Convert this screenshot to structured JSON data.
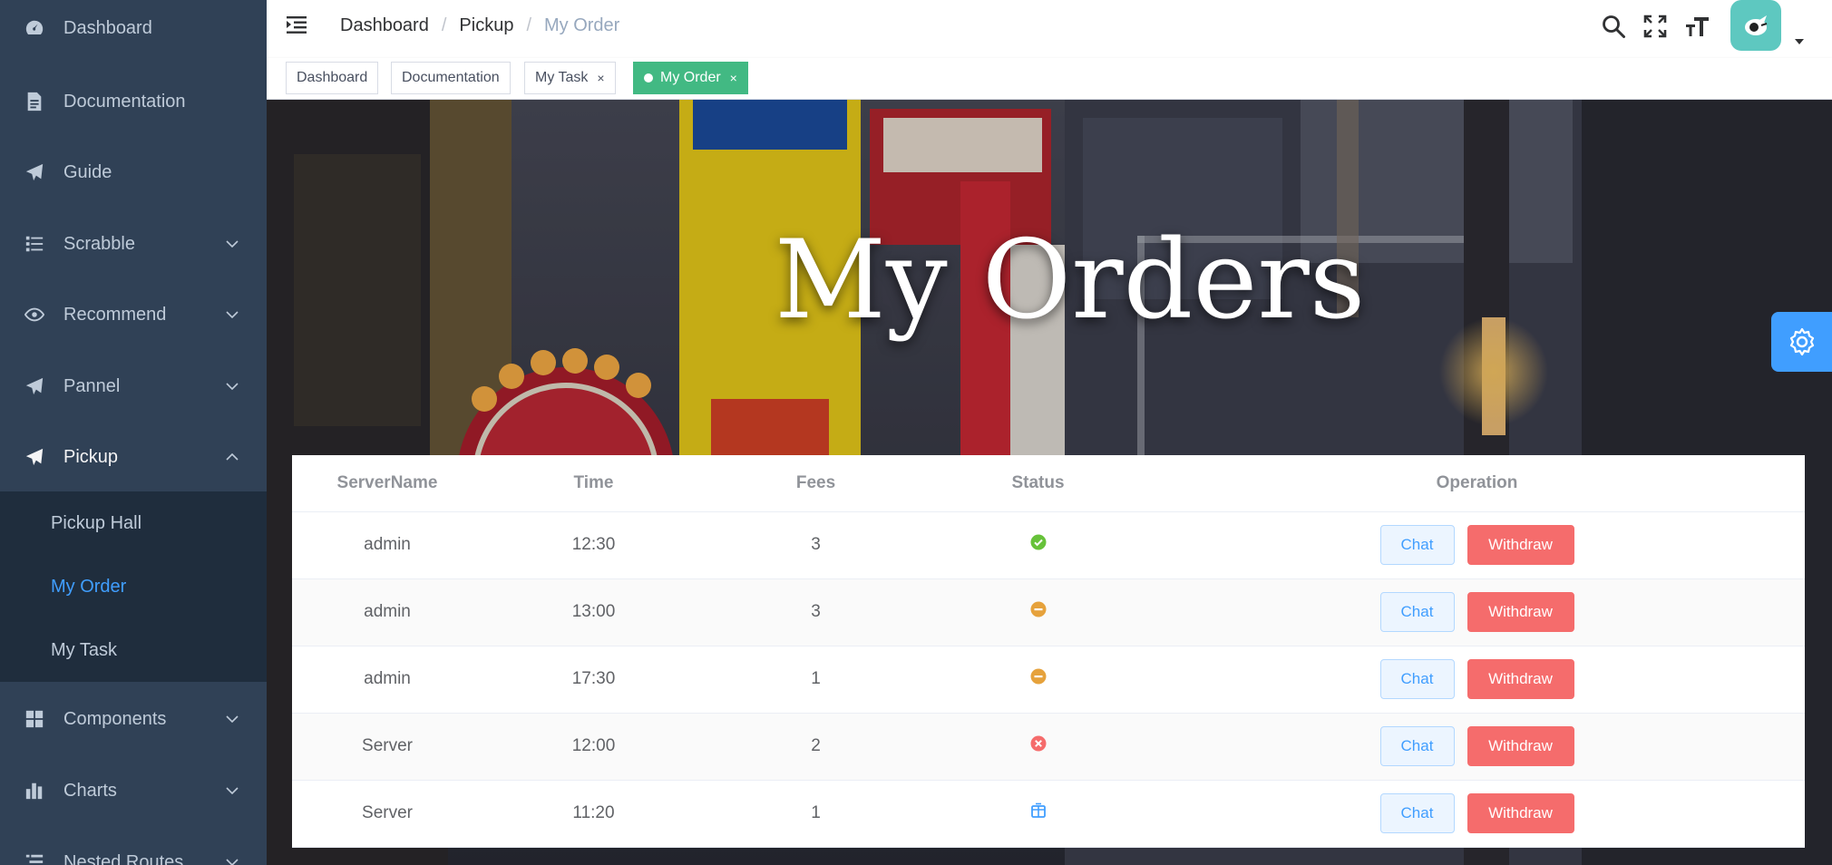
{
  "sidebar": {
    "items": [
      {
        "label": "Dashboard",
        "icon": "dashboard-icon"
      },
      {
        "label": "Documentation",
        "icon": "documentation-icon"
      },
      {
        "label": "Guide",
        "icon": "guide-icon"
      },
      {
        "label": "Scrabble",
        "icon": "list-icon",
        "expandable": true
      },
      {
        "label": "Recommend",
        "icon": "eye-icon",
        "expandable": true
      },
      {
        "label": "Pannel",
        "icon": "send-icon",
        "expandable": true
      },
      {
        "label": "Pickup",
        "icon": "send-icon",
        "expandable": true,
        "expanded": true
      },
      {
        "label": "Components",
        "icon": "components-icon",
        "expandable": true
      },
      {
        "label": "Charts",
        "icon": "chart-icon",
        "expandable": true
      },
      {
        "label": "Nested Routes",
        "icon": "nested-icon",
        "expandable": true
      }
    ],
    "pickup_children": [
      {
        "label": "Pickup Hall"
      },
      {
        "label": "My Order",
        "active": true
      },
      {
        "label": "My Task"
      }
    ]
  },
  "navbar": {
    "breadcrumb": [
      "Dashboard",
      "Pickup",
      "My Order"
    ],
    "separator": "/",
    "tools": [
      "search-icon",
      "fullscreen-icon",
      "font-size-icon"
    ]
  },
  "tags": [
    {
      "label": "Dashboard",
      "closable": false
    },
    {
      "label": "Documentation",
      "closable": false
    },
    {
      "label": "My Task",
      "closable": true
    },
    {
      "label": "My Order",
      "closable": true,
      "active": true
    }
  ],
  "tag_close_glyph": "×",
  "hero": {
    "title": "My Orders"
  },
  "table": {
    "columns": [
      "ServerName",
      "Time",
      "Fees",
      "Status",
      "Operation"
    ],
    "rows": [
      {
        "server": "admin",
        "time": "12:30",
        "fees": "3",
        "status": "completed"
      },
      {
        "server": "admin",
        "time": "13:00",
        "fees": "3",
        "status": "pending"
      },
      {
        "server": "admin",
        "time": "17:30",
        "fees": "1",
        "status": "pending"
      },
      {
        "server": "Server",
        "time": "12:00",
        "fees": "2",
        "status": "cancelled"
      },
      {
        "server": "Server",
        "time": "11:20",
        "fees": "1",
        "status": "packaged"
      }
    ],
    "chat_label": "Chat",
    "withdraw_label": "Withdraw"
  },
  "colors": {
    "sidebar_bg": "#304156",
    "submenu_bg": "#1f2d3d",
    "accent": "#409eff",
    "tag_active": "#42b983",
    "danger": "#f56c6c",
    "success": "#67c23a",
    "warning": "#e6a23c"
  }
}
